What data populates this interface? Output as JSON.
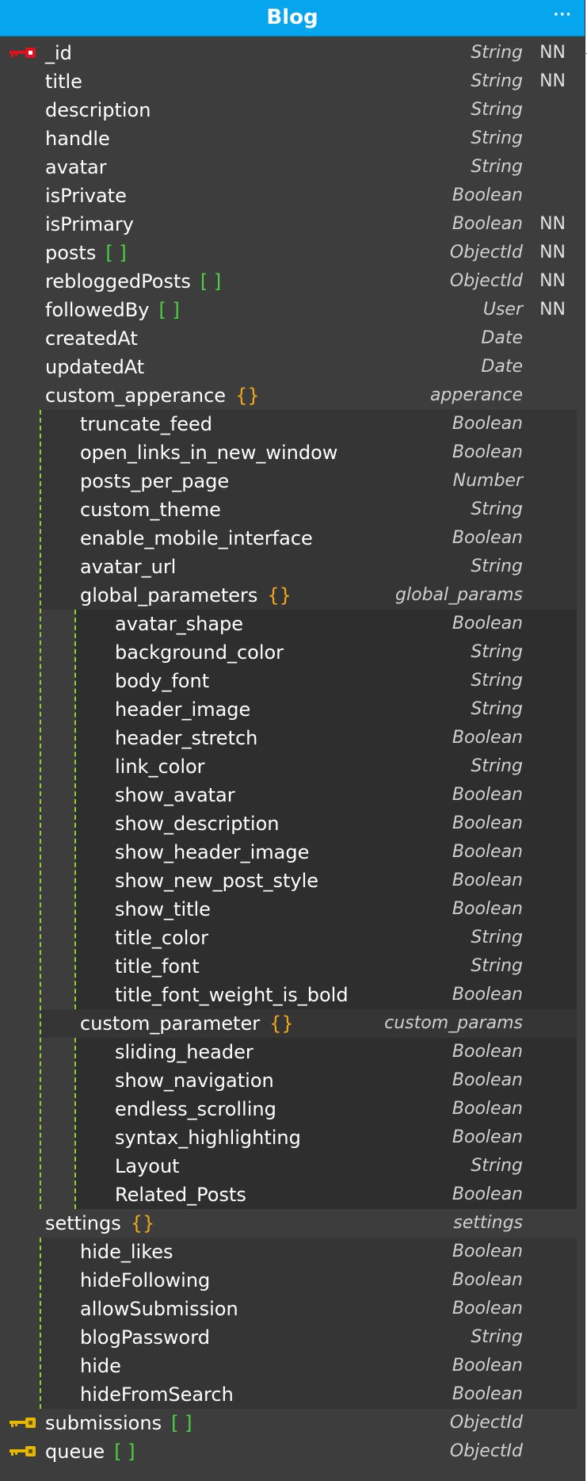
{
  "entity": {
    "title": "Blog",
    "menu_icon": "ellipsis-icon",
    "colors": {
      "header": "#05a6ee",
      "body": "#3d3d3d",
      "nested_level_1": "#353535",
      "nested_level_2": "#2e2e2e",
      "array_bracket": "#4ad140",
      "object_brace": "#f0a818",
      "guide_line": "#8fcf2e",
      "primary_key": "#e0101c",
      "foreign_key": "#e6b800"
    },
    "fields": [
      {
        "name": "_id",
        "type": "String",
        "nn": "NN",
        "level": 0,
        "key": "primary"
      },
      {
        "name": "title",
        "type": "String",
        "nn": "NN",
        "level": 0
      },
      {
        "name": "description",
        "type": "String",
        "level": 0
      },
      {
        "name": "handle",
        "type": "String",
        "level": 0
      },
      {
        "name": "avatar",
        "type": "String",
        "level": 0
      },
      {
        "name": "isPrivate",
        "type": "Boolean",
        "level": 0
      },
      {
        "name": "isPrimary",
        "type": "Boolean",
        "nn": "NN",
        "level": 0
      },
      {
        "name": "posts",
        "bracket": "[ ]",
        "type": "ObjectId",
        "nn": "NN",
        "level": 0
      },
      {
        "name": "rebloggedPosts",
        "bracket": "[ ]",
        "type": "ObjectId",
        "nn": "NN",
        "level": 0
      },
      {
        "name": "followedBy",
        "bracket": "[ ]",
        "type": "User",
        "nn": "NN",
        "level": 0
      },
      {
        "name": "createdAt",
        "type": "Date",
        "level": 0
      },
      {
        "name": "updatedAt",
        "type": "Date",
        "level": 0
      },
      {
        "name": "custom_apperance",
        "bracket": "{}",
        "type": "apperance",
        "level": 0
      },
      {
        "name": "truncate_feed",
        "type": "Boolean",
        "level": 1
      },
      {
        "name": "open_links_in_new_window",
        "type": "Boolean",
        "level": 1
      },
      {
        "name": "posts_per_page",
        "type": "Number",
        "level": 1
      },
      {
        "name": "custom_theme",
        "type": "String",
        "level": 1
      },
      {
        "name": "enable_mobile_interface",
        "type": "Boolean",
        "level": 1
      },
      {
        "name": "avatar_url",
        "type": "String",
        "level": 1
      },
      {
        "name": "global_parameters",
        "bracket": "{}",
        "type": "global_params",
        "level": 1
      },
      {
        "name": "avatar_shape",
        "type": "Boolean",
        "level": 2
      },
      {
        "name": "background_color",
        "type": "String",
        "level": 2
      },
      {
        "name": "body_font",
        "type": "String",
        "level": 2
      },
      {
        "name": "header_image",
        "type": "String",
        "level": 2
      },
      {
        "name": "header_stretch",
        "type": "Boolean",
        "level": 2
      },
      {
        "name": "link_color",
        "type": "String",
        "level": 2
      },
      {
        "name": "show_avatar",
        "type": "Boolean",
        "level": 2
      },
      {
        "name": "show_description",
        "type": "Boolean",
        "level": 2
      },
      {
        "name": "show_header_image",
        "type": "Boolean",
        "level": 2
      },
      {
        "name": "show_new_post_style",
        "type": "Boolean",
        "level": 2
      },
      {
        "name": "show_title",
        "type": "Boolean",
        "level": 2
      },
      {
        "name": "title_color",
        "type": "String",
        "level": 2
      },
      {
        "name": "title_font",
        "type": "String",
        "level": 2
      },
      {
        "name": "title_font_weight_is_bold",
        "type": "Boolean",
        "level": 2
      },
      {
        "name": "custom_parameter",
        "bracket": "{}",
        "type": "custom_params",
        "level": 1
      },
      {
        "name": "sliding_header",
        "type": "Boolean",
        "level": 2
      },
      {
        "name": "show_navigation",
        "type": "Boolean",
        "level": 2
      },
      {
        "name": "endless_scrolling",
        "type": "Boolean",
        "level": 2
      },
      {
        "name": "syntax_highlighting",
        "type": "Boolean",
        "level": 2
      },
      {
        "name": "Layout",
        "type": "String",
        "level": 2
      },
      {
        "name": "Related_Posts",
        "type": "Boolean",
        "level": 2
      },
      {
        "name": "settings",
        "bracket": "{}",
        "type": "settings",
        "level": 0
      },
      {
        "name": "hide_likes",
        "type": "Boolean",
        "level": 1
      },
      {
        "name": "hideFollowing",
        "type": "Boolean",
        "level": 1
      },
      {
        "name": "allowSubmission",
        "type": "Boolean",
        "level": 1
      },
      {
        "name": "blogPassword",
        "type": "String",
        "level": 1
      },
      {
        "name": "hide",
        "type": "Boolean",
        "level": 1
      },
      {
        "name": "hideFromSearch",
        "type": "Boolean",
        "level": 1
      },
      {
        "name": "submissions",
        "bracket": "[ ]",
        "type": "ObjectId",
        "level": 0,
        "key": "foreign"
      },
      {
        "name": "queue",
        "bracket": "[ ]",
        "type": "ObjectId",
        "level": 0,
        "key": "foreign"
      }
    ]
  }
}
